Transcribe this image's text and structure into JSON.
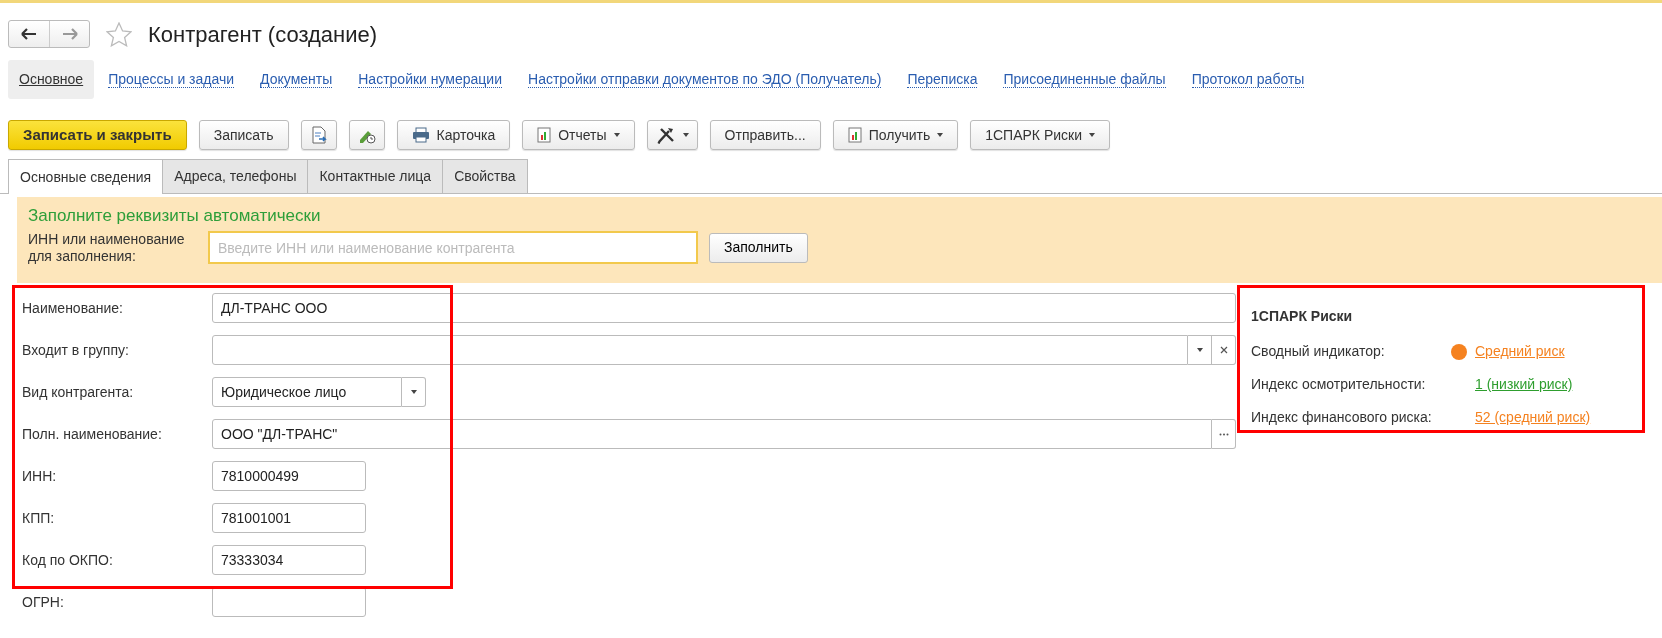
{
  "window": {
    "title": "Контрагент (создание)"
  },
  "nav_links": [
    {
      "label": "Основное",
      "selected": true
    },
    {
      "label": "Процессы и задачи",
      "selected": false
    },
    {
      "label": "Документы",
      "selected": false
    },
    {
      "label": "Настройки нумерации",
      "selected": false
    },
    {
      "label": "Настройки отправки документов по ЭДО (Получатель)",
      "selected": false
    },
    {
      "label": "Переписка",
      "selected": false
    },
    {
      "label": "Присоединенные файлы",
      "selected": false
    },
    {
      "label": "Протокол работы",
      "selected": false
    }
  ],
  "toolbar": [
    {
      "kind": "primary",
      "label": "Записать и закрыть",
      "dropdown": false
    },
    {
      "kind": "plain",
      "label": "Записать",
      "dropdown": false
    },
    {
      "kind": "icon",
      "dropdown": false
    },
    {
      "kind": "icon",
      "dropdown": false
    },
    {
      "kind": "icontext",
      "label": "Карточка",
      "dropdown": false
    },
    {
      "kind": "icontext",
      "label": "Отчеты",
      "dropdown": true
    },
    {
      "kind": "icon",
      "dropdown": true
    },
    {
      "kind": "plain",
      "label": "Отправить...",
      "dropdown": false
    },
    {
      "kind": "icontext",
      "label": "Получить",
      "dropdown": true
    },
    {
      "kind": "plain",
      "label": "1СПАРК Риски",
      "dropdown": true
    }
  ],
  "tabs": [
    {
      "label": "Основные сведения",
      "selected": true
    },
    {
      "label": "Адреса, телефоны",
      "selected": false
    },
    {
      "label": "Контактные лица",
      "selected": false
    },
    {
      "label": "Свойства",
      "selected": false
    }
  ],
  "autofill": {
    "title": "Заполните реквизиты автоматически",
    "label": "ИНН или наименование для заполнения:",
    "placeholder": "Введите ИНН или наименование контрагента",
    "button": "Заполнить"
  },
  "fields": [
    {
      "kind": "wide",
      "label": "Наименование:",
      "value": "ДЛ-ТРАНС ООО"
    },
    {
      "kind": "group",
      "label": "Входит в группу:"
    },
    {
      "kind": "select",
      "label": "Вид контрагента:",
      "value": "Юридическое лицо"
    },
    {
      "kind": "picker",
      "label": "Полн. наименование:",
      "value": "ООО \"ДЛ-ТРАНС\""
    },
    {
      "kind": "short",
      "label": "ИНН:",
      "value": "7810000499"
    },
    {
      "kind": "short",
      "label": "КПП:",
      "value": "781001001"
    },
    {
      "kind": "short",
      "label": "Код по ОКПО:",
      "value": "73333034"
    },
    {
      "kind": "short",
      "label": "ОГРН:"
    }
  ],
  "risk_panel": {
    "title": "1СПАРК Риски",
    "rows": [
      {
        "label": "Сводный индикатор:",
        "value": "Средний риск",
        "color": "#f58220",
        "indicator": true
      },
      {
        "label": "Индекс осмотрительности:",
        "value": "1 (низкий риск)",
        "color": "#2e9e2e",
        "indicator": false
      },
      {
        "label": "Индекс финансового риска:",
        "value": "52 (средний риск)",
        "color": "#f58220",
        "indicator": false
      }
    ]
  }
}
